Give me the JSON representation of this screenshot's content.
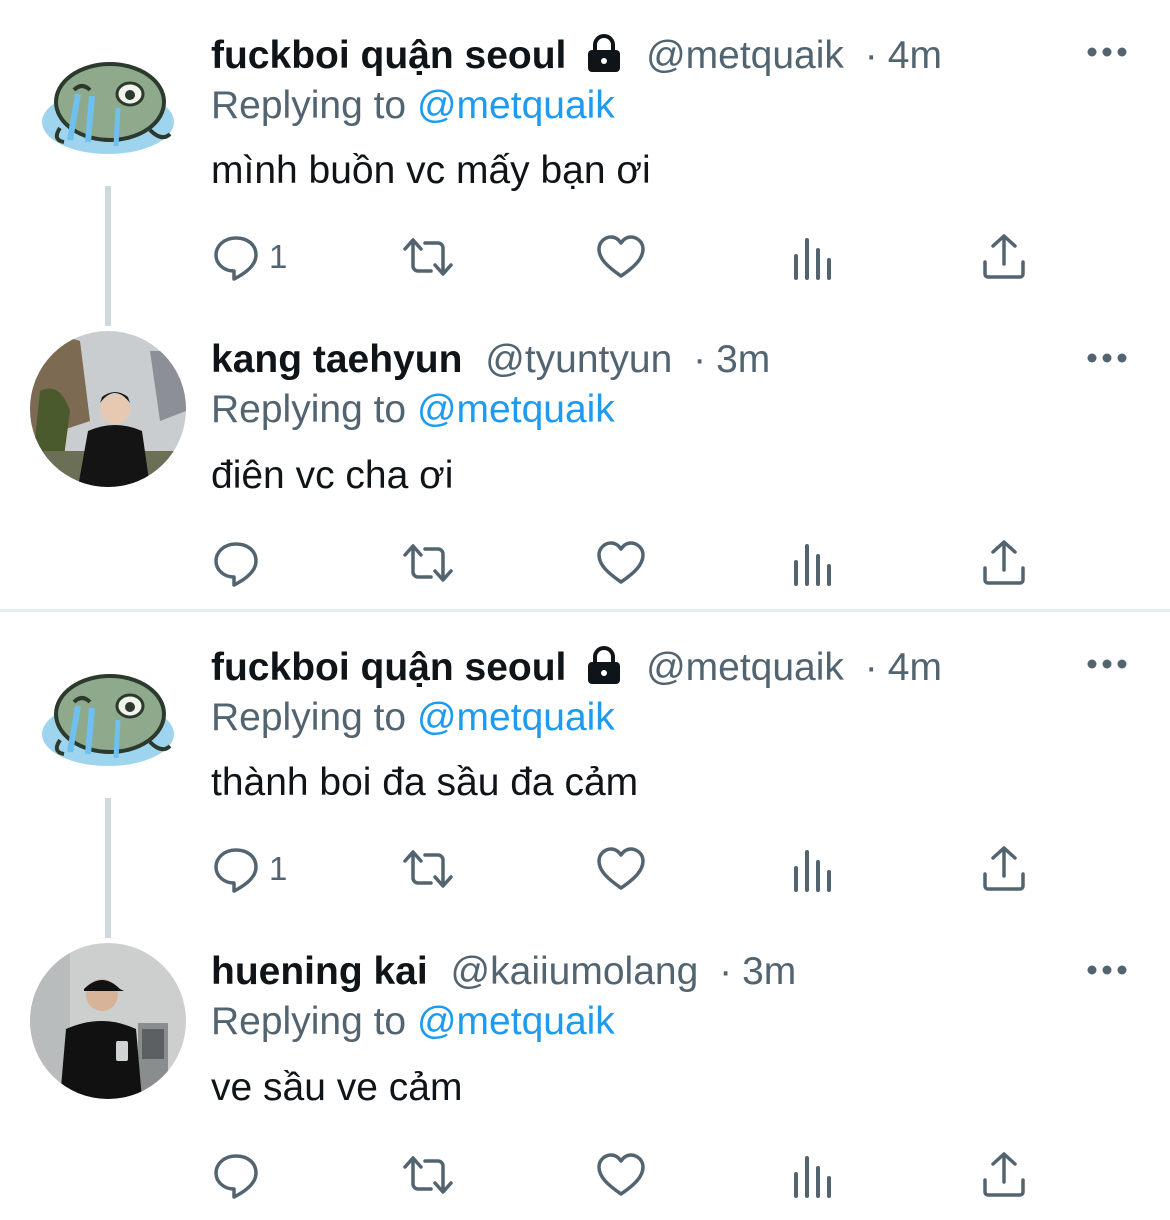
{
  "tweets": [
    {
      "name": "fuckboi quận seoul",
      "protected": true,
      "handle": "@metquaik",
      "time": "4m",
      "replying_prefix": "Replying to",
      "replying_handle": "@metquaik",
      "text": "mình buồn vc mấy bạn ơi",
      "reply_count": "1",
      "avatar_icon": "crying-frog-avatar"
    },
    {
      "name": "kang taehyun",
      "protected": false,
      "handle": "@tyuntyun",
      "time": "3m",
      "replying_prefix": "Replying to",
      "replying_handle": "@metquaik",
      "text": "điên vc cha ơi",
      "reply_count": "",
      "avatar_icon": "user-photo-avatar"
    },
    {
      "name": "fuckboi quận seoul",
      "protected": true,
      "handle": "@metquaik",
      "time": "4m",
      "replying_prefix": "Replying to",
      "replying_handle": "@metquaik",
      "text": "thành boi đa sầu đa cảm",
      "reply_count": "1",
      "avatar_icon": "crying-frog-avatar"
    },
    {
      "name": "huening kai",
      "protected": false,
      "handle": "@kaiiumolang",
      "time": "3m",
      "replying_prefix": "Replying to",
      "replying_handle": "@metquaik",
      "text": "ve sầu ve cảm",
      "reply_count": "",
      "avatar_icon": "user-photo-avatar"
    }
  ],
  "separator_char": "·",
  "colors": {
    "text": "#0f1419",
    "secondary": "#536471",
    "link": "#1d9bf0",
    "thread_line": "#cfd9de"
  }
}
